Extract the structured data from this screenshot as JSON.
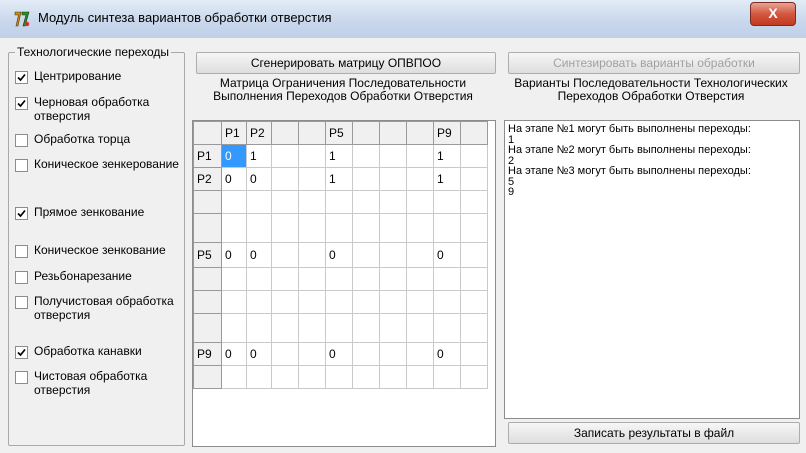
{
  "window": {
    "title": "Модуль синтеза  вариантов обработки отверстия",
    "close_label": "X"
  },
  "transitions_group": {
    "title": "Технологические переходы",
    "items": [
      {
        "label": "Центрирование",
        "checked": true
      },
      {
        "label": "Черновая обработка отверстия",
        "checked": true
      },
      {
        "label": "Обработка торца",
        "checked": false
      },
      {
        "label": "Коническое зенкерование",
        "checked": false
      },
      {
        "label": "Прямое зенкование",
        "checked": true
      },
      {
        "label": "Коническое зенкование",
        "checked": false
      },
      {
        "label": "Резьбонарезание",
        "checked": false
      },
      {
        "label": "Получистовая обработка отверстия",
        "checked": false
      },
      {
        "label": "Обработка канавки",
        "checked": true
      },
      {
        "label": "Чистовая обработка отверстия",
        "checked": false
      }
    ]
  },
  "matrix_panel": {
    "generate_button": "Сгенерировать матрицу ОПВПОО",
    "caption": "Матрица Ограничения Последовательности Выполнения Переходов Обработки Отверстия",
    "columns": [
      "",
      "P1",
      "P2",
      "",
      "",
      "P5",
      "",
      "",
      "",
      "P9",
      ""
    ],
    "rows": [
      [
        "P1",
        "0",
        "1",
        "",
        "",
        "1",
        "",
        "",
        "",
        "1",
        ""
      ],
      [
        "P2",
        "0",
        "0",
        "",
        "",
        "1",
        "",
        "",
        "",
        "1",
        ""
      ],
      [
        "",
        "",
        "",
        "",
        "",
        "",
        "",
        "",
        "",
        "",
        ""
      ],
      [
        "",
        "",
        "",
        "",
        "",
        "",
        "",
        "",
        "",
        "",
        ""
      ],
      [
        "P5",
        "0",
        "0",
        "",
        "",
        "0",
        "",
        "",
        "",
        "0",
        ""
      ],
      [
        "",
        "",
        "",
        "",
        "",
        "",
        "",
        "",
        "",
        "",
        ""
      ],
      [
        "",
        "",
        "",
        "",
        "",
        "",
        "",
        "",
        "",
        "",
        ""
      ],
      [
        "",
        "",
        "",
        "",
        "",
        "",
        "",
        "",
        "",
        "",
        ""
      ],
      [
        "P9",
        "0",
        "0",
        "",
        "",
        "0",
        "",
        "",
        "",
        "0",
        ""
      ],
      [
        "",
        "",
        "",
        "",
        "",
        "",
        "",
        "",
        "",
        "",
        ""
      ]
    ]
  },
  "variants_panel": {
    "synthesize_button": "Синтезировать варианты обработки",
    "caption": "Варианты Последовательности Технологических Переходов Обработки Отверстия",
    "lines": [
      "На этапе №1 могут быть выполнены переходы:",
      "1",
      "На этапе №2 могут быть выполнены переходы:",
      "2",
      "На этапе №3 могут быть выполнены переходы:",
      "5",
      "9"
    ],
    "save_button": "Записать результаты в файл"
  }
}
